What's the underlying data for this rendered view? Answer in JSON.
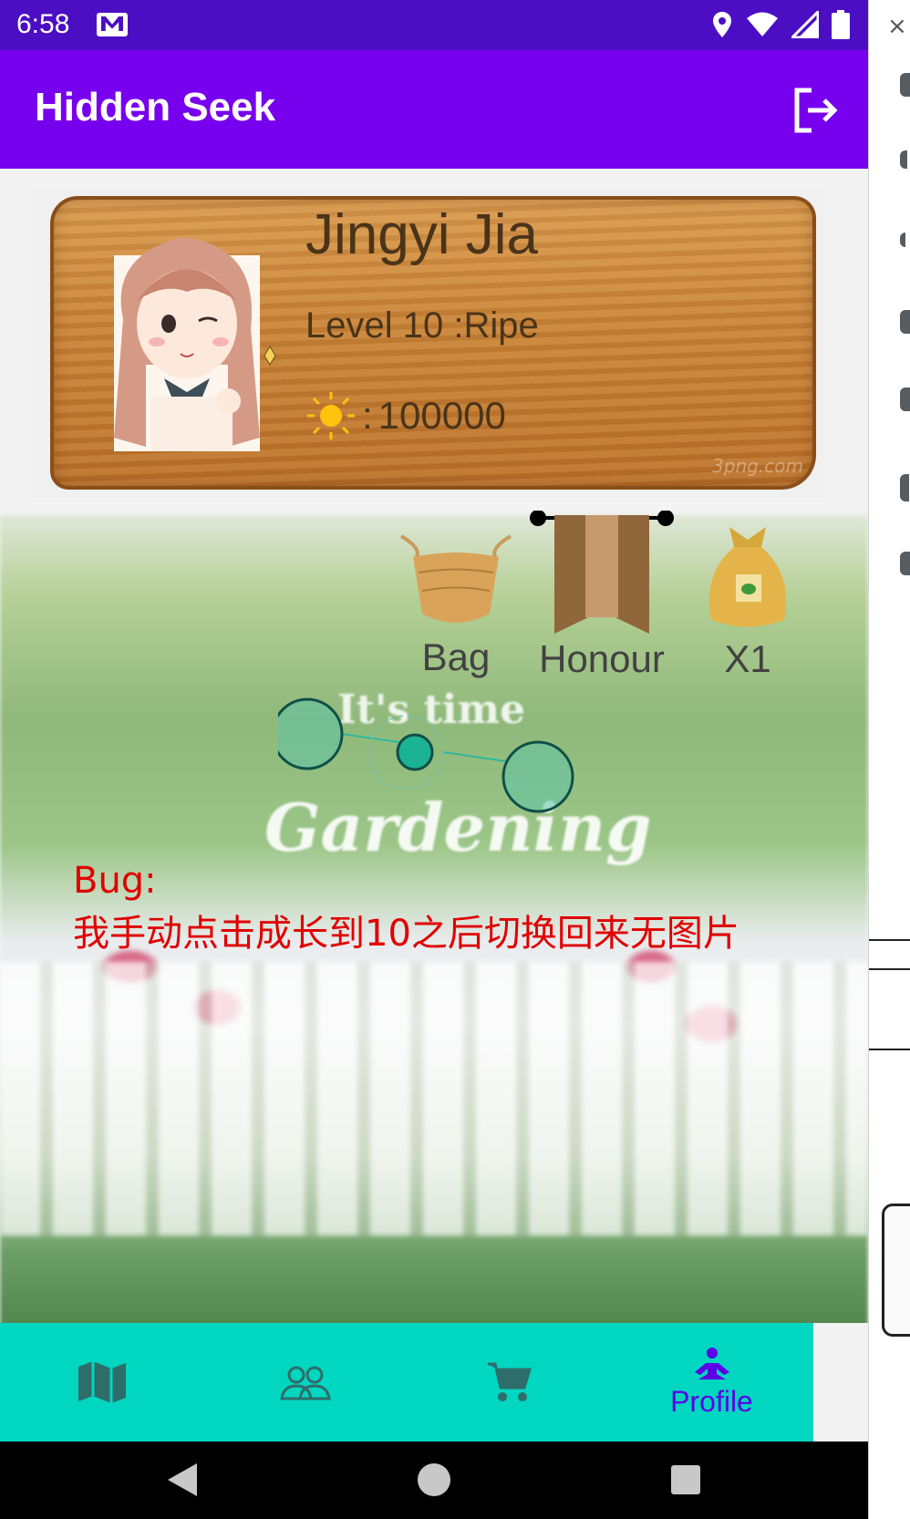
{
  "status_bar": {
    "time": "6:58",
    "icons": [
      "gmail-icon",
      "location-icon",
      "wifi-icon",
      "signal-icon",
      "battery-icon"
    ]
  },
  "app_bar": {
    "title": "Hidden Seek",
    "action_icon": "logout-icon"
  },
  "profile": {
    "name": "Jingyi Jia",
    "level": "Level 10 :Ripe",
    "points_prefix": ": ",
    "points": "100000",
    "watermark": "3png.com"
  },
  "items": [
    {
      "label": "Bag",
      "icon": "basket-icon"
    },
    {
      "label": "Honour",
      "icon": "ribbon-banner-icon"
    },
    {
      "label": "X1",
      "icon": "seed-sack-icon"
    }
  ],
  "background": {
    "line1": "It's time",
    "line2": "Gardening"
  },
  "bug_note": {
    "line1": "Bug:",
    "line2": "我手动点击成长到10之后切换回来无图片"
  },
  "bottom_nav": {
    "items": [
      {
        "icon": "map-icon",
        "label": ""
      },
      {
        "icon": "friends-icon",
        "label": ""
      },
      {
        "icon": "cart-icon",
        "label": ""
      },
      {
        "icon": "meditation-profile-icon",
        "label": "Profile"
      }
    ],
    "active_index": 3
  },
  "colors": {
    "status_bar": "#4b0ec3",
    "app_bar": "#7700ee",
    "bottom_nav": "#00d6c0",
    "active_nav": "#5d00e8",
    "bug_text": "#e00000"
  }
}
